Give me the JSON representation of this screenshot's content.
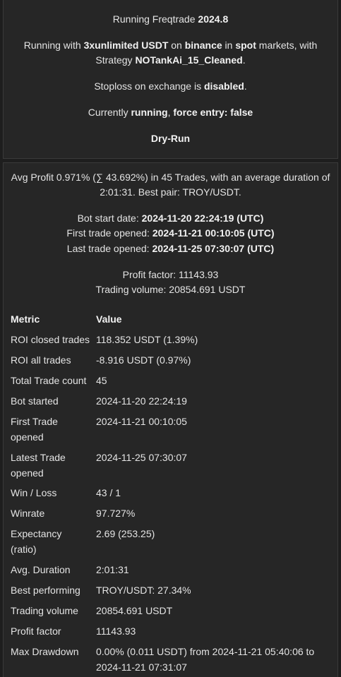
{
  "header": {
    "running_prefix": "Running Freqtrade",
    "version": "2024.8",
    "running_with": "Running with",
    "stake_currency": "3xunlimited USDT",
    "on": "on",
    "exchange": "binance",
    "in": "in",
    "market": "spot",
    "markets_with": "markets, with",
    "strategy_label": "Strategy",
    "strategy": "NOTankAi_15_Cleaned",
    "period": ".",
    "stoploss_prefix": "Stoploss on exchange is",
    "stoploss_status": "disabled",
    "currently": "Currently",
    "state": "running",
    "force_entry": "force entry: false",
    "dry_run": "Dry-Run"
  },
  "summary": {
    "avg_profit_line1": "Avg Profit 0.971% (∑ 43.692%) in 45 Trades, with an average duration of",
    "avg_profit_line2": "2:01:31. Best pair: TROY/USDT.",
    "bot_start_label": "Bot start date:",
    "bot_start_value": "2024-11-20 22:24:19 (UTC)",
    "first_trade_label": "First trade opened:",
    "first_trade_value": "2024-11-21 00:10:05 (UTC)",
    "last_trade_label": "Last trade opened:",
    "last_trade_value": "2024-11-25 07:30:07 (UTC)",
    "profit_factor_line": "Profit factor: 11143.93",
    "trading_volume_line": "Trading volume: 20854.691 USDT"
  },
  "table": {
    "header_metric": "Metric",
    "header_value": "Value",
    "rows": [
      {
        "metric": "ROI closed trades",
        "value": "118.352 USDT (1.39%)"
      },
      {
        "metric": "ROI all trades",
        "value": "-8.916 USDT (0.97%)"
      },
      {
        "metric": "Total Trade count",
        "value": "45"
      },
      {
        "metric": "Bot started",
        "value": "2024-11-20 22:24:19"
      },
      {
        "metric": "First Trade",
        "metric2": "opened",
        "value": "2024-11-21 00:10:05"
      },
      {
        "metric": "Latest Trade",
        "metric2": "opened",
        "value": "2024-11-25 07:30:07"
      },
      {
        "metric": "Win / Loss",
        "value": "43 / 1"
      },
      {
        "metric": "Winrate",
        "value": "97.727%"
      },
      {
        "metric": "Expectancy",
        "metric2": "(ratio)",
        "value": "2.69 (253.25)"
      },
      {
        "metric": "Avg. Duration",
        "value": "2:01:31"
      },
      {
        "metric": "Best performing",
        "value": "TROY/USDT: 27.34%"
      },
      {
        "metric": "Trading volume",
        "value": "20854.691 USDT"
      },
      {
        "metric": "Profit factor",
        "value": "11143.93"
      },
      {
        "metric": "Max Drawdown",
        "value": "0.00% (0.011 USDT) from 2024-11-21 05:40:06 to",
        "value2": "2024-11-21 07:31:07"
      }
    ]
  }
}
